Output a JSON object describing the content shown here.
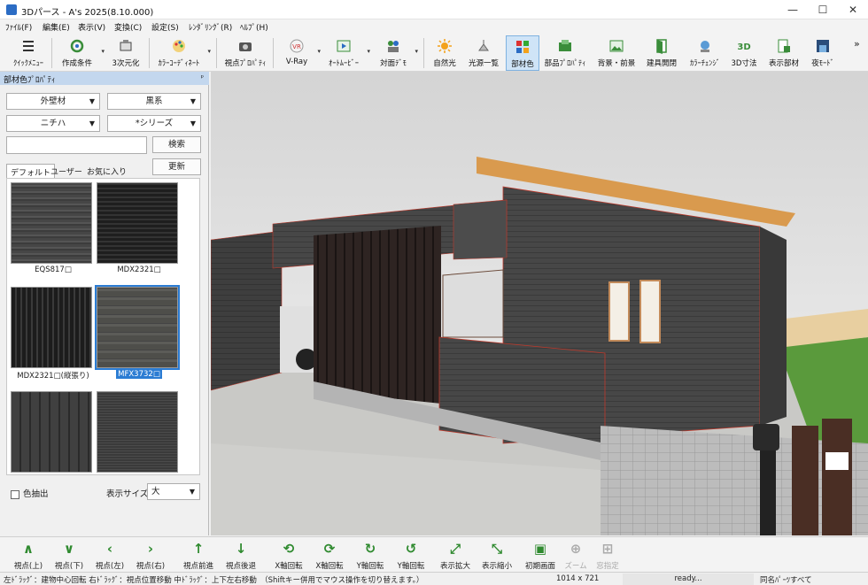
{
  "window": {
    "title": "3Dパース - A's 2025(8.10.000)",
    "min": "—",
    "max": "☐",
    "close": "✕"
  },
  "menu": [
    "ﾌｧｲﾙ(F)",
    "編集(E)",
    "表示(V)",
    "変換(C)",
    "設定(S)",
    "ﾚﾝﾀﾞﾘﾝｸﾞ(R)",
    "ﾍﾙﾌﾟ(H)"
  ],
  "toolbar": [
    {
      "label": "ｸｲｯｸﾒﾆｭｰ",
      "icon": "menu-icon"
    },
    {
      "label": "作成条件",
      "icon": "settings-gear-icon"
    },
    {
      "label": "3次元化",
      "icon": "convert-3d-icon"
    },
    {
      "label": "ｶﾗｰｺｰﾃﾞｨﾈｰﾄ",
      "icon": "color-palette-icon"
    },
    {
      "label": "視点ﾌﾟﾛﾊﾟﾃｨ",
      "icon": "camera-icon"
    },
    {
      "label": "V-Ray",
      "icon": "vray-icon"
    },
    {
      "label": "ｵｰﾄﾑｰﾋﾞｰ",
      "icon": "auto-movie-icon"
    },
    {
      "label": "対面ﾃﾞﾓ",
      "icon": "demo-icon"
    },
    {
      "label": "自然光",
      "icon": "sun-icon"
    },
    {
      "label": "光源一覧",
      "icon": "lamp-icon"
    },
    {
      "label": "部材色",
      "icon": "material-color-icon"
    },
    {
      "label": "部品ﾌﾟﾛﾊﾟﾃｨ",
      "icon": "parts-property-icon"
    },
    {
      "label": "背景・前景",
      "icon": "background-icon"
    },
    {
      "label": "建具開閉",
      "icon": "door-open-icon"
    },
    {
      "label": "ｶﾗｰﾁｪﾝｼﾞ",
      "icon": "color-change-icon"
    },
    {
      "label": "3D寸法",
      "icon": "dimension-3d-icon"
    },
    {
      "label": "表示部材",
      "icon": "display-parts-icon"
    },
    {
      "label": "夜ﾓｰﾄﾞ",
      "icon": "night-mode-icon"
    }
  ],
  "toolbar_more": "»",
  "panel": {
    "title": "部材色ﾌﾟﾛﾊﾟﾃｨ",
    "pin": "ᵖ",
    "combo1": "外壁材",
    "combo2": "黒系",
    "combo3": "ニチハ",
    "combo4": "*シリーズ",
    "search_btn": "検索",
    "refresh_btn": "更新",
    "tabs": [
      "デフォルト",
      "ユーザー",
      "お気に入り"
    ],
    "items": [
      {
        "label": "EQS817□",
        "pattern": "fine"
      },
      {
        "label": "MDX2321□",
        "pattern": "hstripe"
      },
      {
        "label": "MDX2321□(縦張り)",
        "pattern": "vstripe"
      },
      {
        "label": "MFX3732□",
        "pattern": "stone"
      },
      {
        "label": "",
        "pattern": "vwide"
      },
      {
        "label": "",
        "pattern": "hfine"
      }
    ],
    "color_extract": "色抽出",
    "size_label": "表示サイズ",
    "size_value": "大"
  },
  "nav": [
    {
      "label": "視点(上)",
      "icon": "arrow-up-icon",
      "glyph": "∧"
    },
    {
      "label": "視点(下)",
      "icon": "arrow-down-icon",
      "glyph": "∨"
    },
    {
      "label": "視点(左)",
      "icon": "arrow-left-icon",
      "glyph": "‹"
    },
    {
      "label": "視点(右)",
      "icon": "arrow-right-icon",
      "glyph": "›"
    },
    {
      "label": "視点前進",
      "icon": "move-forward-icon",
      "glyph": "↑"
    },
    {
      "label": "視点後退",
      "icon": "move-back-icon",
      "glyph": "↓"
    },
    {
      "label": "X軸回転",
      "icon": "rotate-x-icon",
      "glyph": "⟲"
    },
    {
      "label": "X軸回転",
      "icon": "rotate-x-reverse-icon",
      "glyph": "⟳"
    },
    {
      "label": "Y軸回転",
      "icon": "rotate-y-icon",
      "glyph": "↻"
    },
    {
      "label": "Y軸回転",
      "icon": "rotate-y-reverse-icon",
      "glyph": "↺"
    },
    {
      "label": "表示拡大",
      "icon": "zoom-expand-icon",
      "glyph": "⤢"
    },
    {
      "label": "表示縮小",
      "icon": "zoom-shrink-icon",
      "glyph": "⤡"
    },
    {
      "label": "初期画面",
      "icon": "initial-view-icon",
      "glyph": "▣"
    },
    {
      "label": "ズーム",
      "icon": "zoom-icon",
      "glyph": "⊕"
    },
    {
      "label": "窓指定",
      "icon": "window-select-icon",
      "glyph": "⊞"
    }
  ],
  "status": {
    "hint": "左ﾄﾞﾗｯｸﾞ：建物中心回転  右ﾄﾞﾗｯｸﾞ：視点位置移動  中ﾄﾞﾗｯｸﾞ：上下左右移動　（Shiftキー併用でマウス操作を切り替えます。）",
    "size": "1014 x 721",
    "ready": "ready...",
    "same": "同名ﾊﾟｰﾂすべて"
  },
  "colors": {
    "accent": "#2b7cd3",
    "panel_header": "#c3d7ee",
    "sky": "#e8e8e8",
    "wall": "#4a4a4a"
  }
}
